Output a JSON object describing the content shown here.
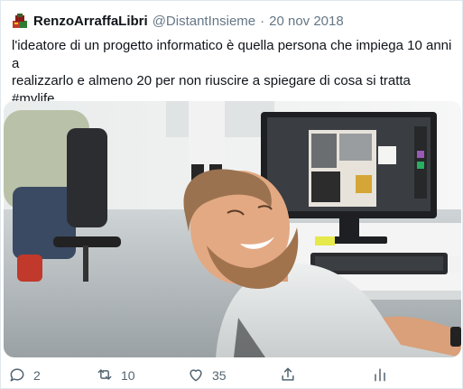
{
  "tweet": {
    "display_name": "RenzoArraffaLibri",
    "handle": "@DistantInsieme",
    "separator": "·",
    "date": "20 nov 2018",
    "text_line_1": "l'ideatore di un progetto informatico è quella persona che impiega 10 anni a",
    "text_line_2": "realizzarlo e almeno 20 per non riuscire a spiegare di cosa si tratta",
    "hashtag": "#mylife",
    "media_icon": "office-photo-laughing-man"
  },
  "actions": {
    "reply_count": "2",
    "retweet_count": "10",
    "like_count": "35",
    "icons": [
      "reply-icon",
      "retweet-icon",
      "like-icon",
      "share-icon",
      "analytics-icon"
    ]
  },
  "colors": {
    "text": "#0f1419",
    "secondary": "#657786",
    "action": "#536471",
    "border": "#e1e8ed"
  }
}
